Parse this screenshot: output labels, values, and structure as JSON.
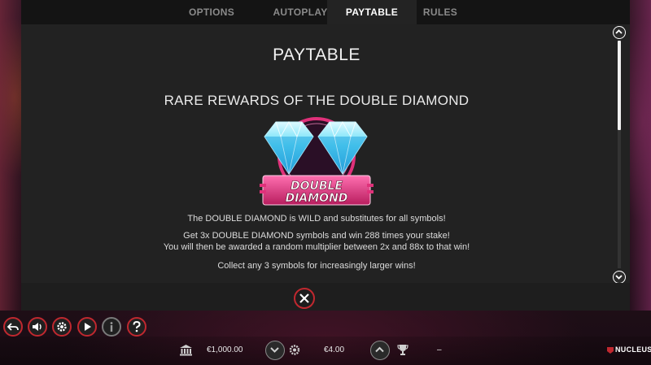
{
  "tabs": [
    {
      "label": "OPTIONS",
      "active": false
    },
    {
      "label": "AUTOPLAY",
      "active": false
    },
    {
      "label": "PAYTABLE",
      "active": true
    },
    {
      "label": "RULES",
      "active": false
    }
  ],
  "content": {
    "page_title": "PAYTABLE",
    "section_title": "RARE REWARDS OF THE DOUBLE DIAMOND",
    "symbol_logo": {
      "line1": "DOUBLE",
      "line2": "DIAMOND"
    },
    "paragraphs": [
      "The DOUBLE DIAMOND is WILD and substitutes for all symbols!",
      "Get 3x DOUBLE DIAMOND symbols and win 288 times your stake!",
      "You will then be awarded a random multiplier between 2x and 88x to that win!",
      "Collect any 3 symbols for increasingly larger wins!"
    ],
    "scroll_position": 0.0
  },
  "status": {
    "balance": "€1,000.00",
    "stake": "€4.00",
    "win": "–"
  },
  "brand": "NUCLEUS",
  "colors": {
    "accent": "#c0282f",
    "panel": "#222222",
    "diamond": "#4fd8f5",
    "logo_pink": "#e0317a"
  },
  "icons": {
    "back": "back-arrow-icon",
    "sound": "speaker-icon",
    "settings": "gear-icon",
    "play": "play-icon",
    "info": "info-icon",
    "help": "question-icon",
    "balance": "bank-icon",
    "stake": "coin-stack-icon",
    "win": "trophy-icon"
  }
}
